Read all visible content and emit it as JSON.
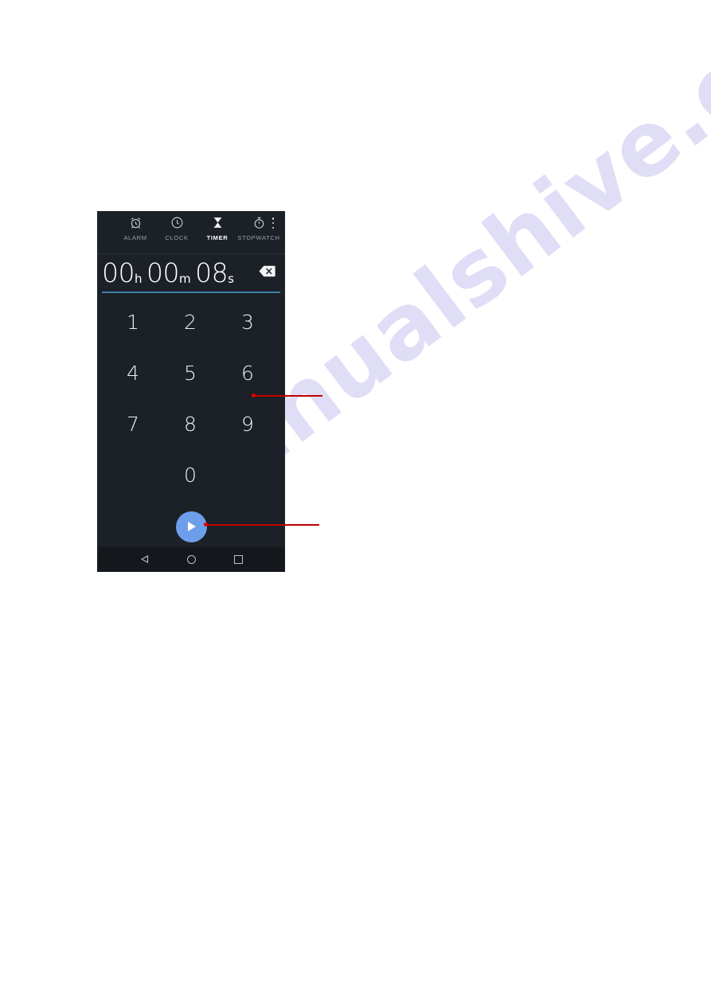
{
  "page": {
    "background_color": "#ffffff",
    "watermark_text": "manualshive.com",
    "watermark_color": "#c8c4f0"
  },
  "device_screenshot": {
    "app_name": "Clock",
    "background_color": "#1b2127",
    "accent_color": "#6d9eeb",
    "underline_color": "#3f7ea8",
    "tabs": [
      {
        "id": "alarm",
        "label": "ALARM",
        "icon": "alarm-clock-icon",
        "active": false
      },
      {
        "id": "clock",
        "label": "CLOCK",
        "icon": "clock-icon",
        "active": false
      },
      {
        "id": "timer",
        "label": "TIMER",
        "icon": "hourglass-icon",
        "active": true
      },
      {
        "id": "stopwatch",
        "label": "STOPWATCH",
        "icon": "stopwatch-icon",
        "active": false
      }
    ],
    "overflow_menu": {
      "icon": "more-vertical-icon",
      "label": "More options"
    },
    "timer_display": {
      "hours": "00",
      "hours_unit": "h",
      "minutes": "00",
      "minutes_unit": "m",
      "seconds": "08",
      "seconds_unit": "s",
      "full_value": "00h 00m 08s",
      "backspace_icon": "backspace-icon"
    },
    "keypad": {
      "keys": [
        "1",
        "2",
        "3",
        "4",
        "5",
        "6",
        "7",
        "8",
        "9",
        "0"
      ]
    },
    "start_button": {
      "icon": "play-icon",
      "label": "Start timer",
      "color": "#6d9eeb"
    },
    "navigation_bar": {
      "buttons": [
        {
          "id": "back",
          "icon": "nav-back-icon",
          "label": "Back"
        },
        {
          "id": "home",
          "icon": "nav-home-icon",
          "label": "Home"
        },
        {
          "id": "recents",
          "icon": "nav-recents-icon",
          "label": "Recent apps"
        }
      ]
    }
  },
  "annotations": {
    "color": "#c00000",
    "callouts": [
      {
        "id": "callout-keypad",
        "target": "keypad-area"
      },
      {
        "id": "callout-start",
        "target": "start-button"
      }
    ]
  }
}
